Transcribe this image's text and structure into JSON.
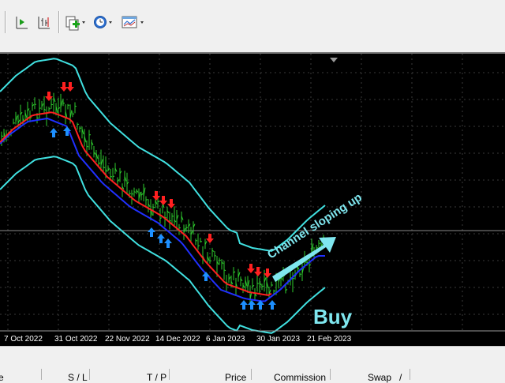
{
  "toolbar": {
    "buttons": [
      {
        "name": "chart-shift-icon"
      },
      {
        "name": "auto-scroll-icon"
      },
      {
        "name": "new-order-icon"
      },
      {
        "name": "periods-icon"
      },
      {
        "name": "templates-icon"
      }
    ]
  },
  "chart": {
    "x_labels": [
      "7 Oct 2022",
      "31 Oct 2022",
      "22 Nov 2022",
      "14 Dec 2022",
      "6 Jan 2023",
      "30 Jan 2023",
      "21 Feb 2023"
    ],
    "annotation": "Channel sloping up",
    "signal_label": "Buy",
    "colors": {
      "bars": "#2ecc2e",
      "upper_band": "#40e0e0",
      "lower_band": "#40e0e0",
      "fast_ma": "#ff2020",
      "slow_ma": "#2030ff",
      "buy_arrows": "#1e90ff",
      "sell_arrows": "#ff2020",
      "annotation": "#7fe7ef"
    }
  },
  "terminal": {
    "columns": [
      "e",
      "S / L",
      "T / P",
      "Price",
      "Commission",
      "Swap",
      "/"
    ]
  }
}
